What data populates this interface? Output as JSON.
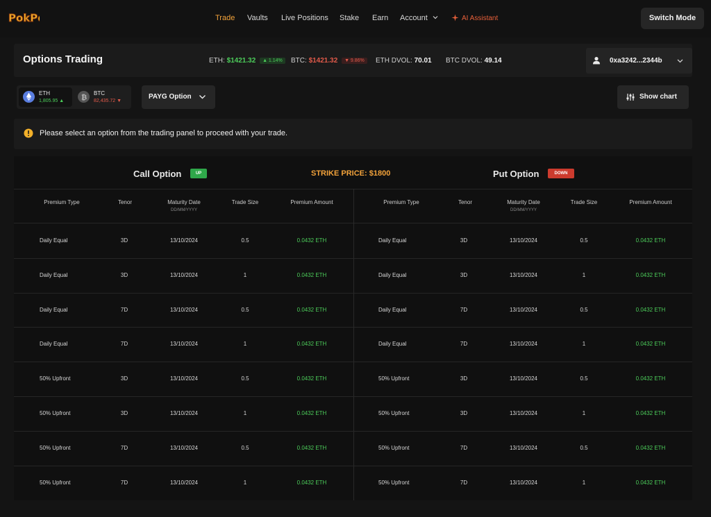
{
  "nav": {
    "logo_text": "PokPok",
    "links": [
      "Trade",
      "Vaults",
      "Live Positions",
      "Stake",
      "Earn"
    ],
    "account": "Account",
    "ai_assistant": "AI Assistant",
    "switch_mode": "Switch Mode",
    "active": "Trade"
  },
  "header": {
    "title": "Options Trading",
    "eth_label": "ETH:",
    "eth_price": "$1421.32",
    "eth_change": "▲ 1.14%",
    "btc_label": "BTC:",
    "btc_price": "$1421.32",
    "btc_change": "▼ 9.86%",
    "eth_dvol_label": "ETH DVOL:",
    "eth_dvol": "70.01",
    "btc_dvol_label": "BTC DVOL:",
    "btc_dvol": "49.14",
    "wallet": "0xa3242...2344b"
  },
  "assets": {
    "eth": {
      "name": "ETH",
      "price": "1,805.95 ▲"
    },
    "btc": {
      "name": "BTC",
      "price": "82,435.72 ▼"
    },
    "option_type": "PAYG Option",
    "show_chart": "Show chart"
  },
  "alert": {
    "message": "Please select an option from the trading panel to proceed with your trade."
  },
  "table": {
    "call_title": "Call Option",
    "call_tag": "UP",
    "strike": "STRIKE PRICE: $1800",
    "put_title": "Put Option",
    "put_tag": "DOWN",
    "columns": [
      "Premium Type",
      "Tenor",
      "Maturity Date",
      "Trade Size",
      "Premium Amount"
    ],
    "date_format": "DD/MM/YYYY",
    "call_rows": [
      [
        "Daily Equal",
        "3D",
        "13/10/2024",
        "0.5",
        "0.0432 ETH"
      ],
      [
        "Daily Equal",
        "3D",
        "13/10/2024",
        "1",
        "0.0432 ETH"
      ],
      [
        "Daily Equal",
        "7D",
        "13/10/2024",
        "0.5",
        "0.0432 ETH"
      ],
      [
        "Daily Equal",
        "7D",
        "13/10/2024",
        "1",
        "0.0432 ETH"
      ],
      [
        "50% Upfront",
        "3D",
        "13/10/2024",
        "0.5",
        "0.0432 ETH"
      ],
      [
        "50% Upfront",
        "3D",
        "13/10/2024",
        "1",
        "0.0432 ETH"
      ],
      [
        "50% Upfront",
        "7D",
        "13/10/2024",
        "0.5",
        "0.0432 ETH"
      ],
      [
        "50% Upfront",
        "7D",
        "13/10/2024",
        "1",
        "0.0432 ETH"
      ]
    ],
    "put_rows": [
      [
        "Daily Equal",
        "3D",
        "13/10/2024",
        "0.5",
        "0.0432 ETH"
      ],
      [
        "Daily Equal",
        "3D",
        "13/10/2024",
        "1",
        "0.0432 ETH"
      ],
      [
        "Daily Equal",
        "7D",
        "13/10/2024",
        "0.5",
        "0.0432 ETH"
      ],
      [
        "Daily Equal",
        "7D",
        "13/10/2024",
        "1",
        "0.0432 ETH"
      ],
      [
        "50% Upfront",
        "3D",
        "13/10/2024",
        "0.5",
        "0.0432 ETH"
      ],
      [
        "50% Upfront",
        "3D",
        "13/10/2024",
        "1",
        "0.0432 ETH"
      ],
      [
        "50% Upfront",
        "7D",
        "13/10/2024",
        "0.5",
        "0.0432 ETH"
      ],
      [
        "50% Upfront",
        "7D",
        "13/10/2024",
        "1",
        "0.0432 ETH"
      ]
    ]
  },
  "colors": {
    "accent": "#f2a23a",
    "positive": "#4ccd5a",
    "negative": "#e25a4a",
    "ai": "#e8603a"
  }
}
